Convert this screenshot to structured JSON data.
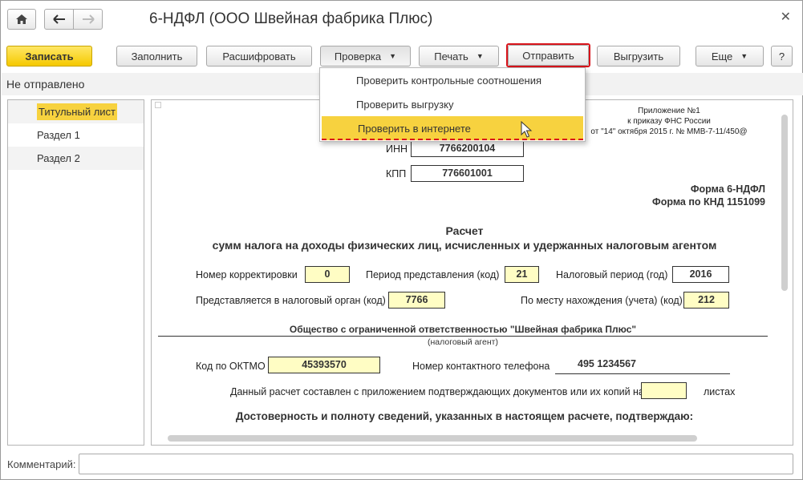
{
  "window": {
    "title": "6-НДФЛ (ООО Швейная фабрика Плюс)",
    "status": "Не отправлено"
  },
  "toolbar": {
    "save": "Записать",
    "fill": "Заполнить",
    "decode": "Расшифровать",
    "check": "Проверка",
    "print": "Печать",
    "send": "Отправить",
    "export": "Выгрузить",
    "more": "Еще",
    "help": "?"
  },
  "check_menu": {
    "items": [
      "Проверить контрольные соотношения",
      "Проверить выгрузку",
      "Проверить в интернете"
    ]
  },
  "sidebar": {
    "items": [
      {
        "label": "Титульный лист"
      },
      {
        "label": "Раздел 1"
      },
      {
        "label": "Раздел 2"
      }
    ]
  },
  "form": {
    "appendix": [
      "Приложение №1",
      "к приказу ФНС России",
      "от \"14\" октября 2015 г. № ММВ-7-11/450@"
    ],
    "inn_label": "ИНН",
    "inn": "7766200104",
    "kpp_label": "КПП",
    "kpp": "776601001",
    "form_name": "Форма 6-НДФЛ",
    "form_knd": "Форма по КНД 1151099",
    "heading1": "Расчет",
    "heading2": "сумм налога на доходы физических лиц, исчисленных и удержанных налоговым агентом",
    "correction_label": "Номер корректировки",
    "correction": "0",
    "period_label": "Период представления (код)",
    "period": "21",
    "tax_period_label": "Налоговый период (год)",
    "tax_period": "2016",
    "tax_authority_label": "Представляется в налоговый орган (код)",
    "tax_authority": "7766",
    "location_label": "По месту нахождения (учета) (код)",
    "location": "212",
    "org_name": "Общество с ограниченной ответственностью \"Швейная фабрика Плюс\"",
    "org_caption": "(налоговый агент)",
    "oktmo_label": "Код по ОКТМО",
    "oktmo": "45393570",
    "phone_label": "Номер контактного телефона",
    "phone": "495 1234567",
    "pages_text": "Данный расчет составлен с приложением подтверждающих документов или их копий на",
    "pages_suffix": "листах",
    "confirm_text": "Достоверность и полноту сведений, указанных в настоящем расчете, подтверждаю:"
  },
  "comment": {
    "label": "Комментарий:",
    "value": ""
  }
}
